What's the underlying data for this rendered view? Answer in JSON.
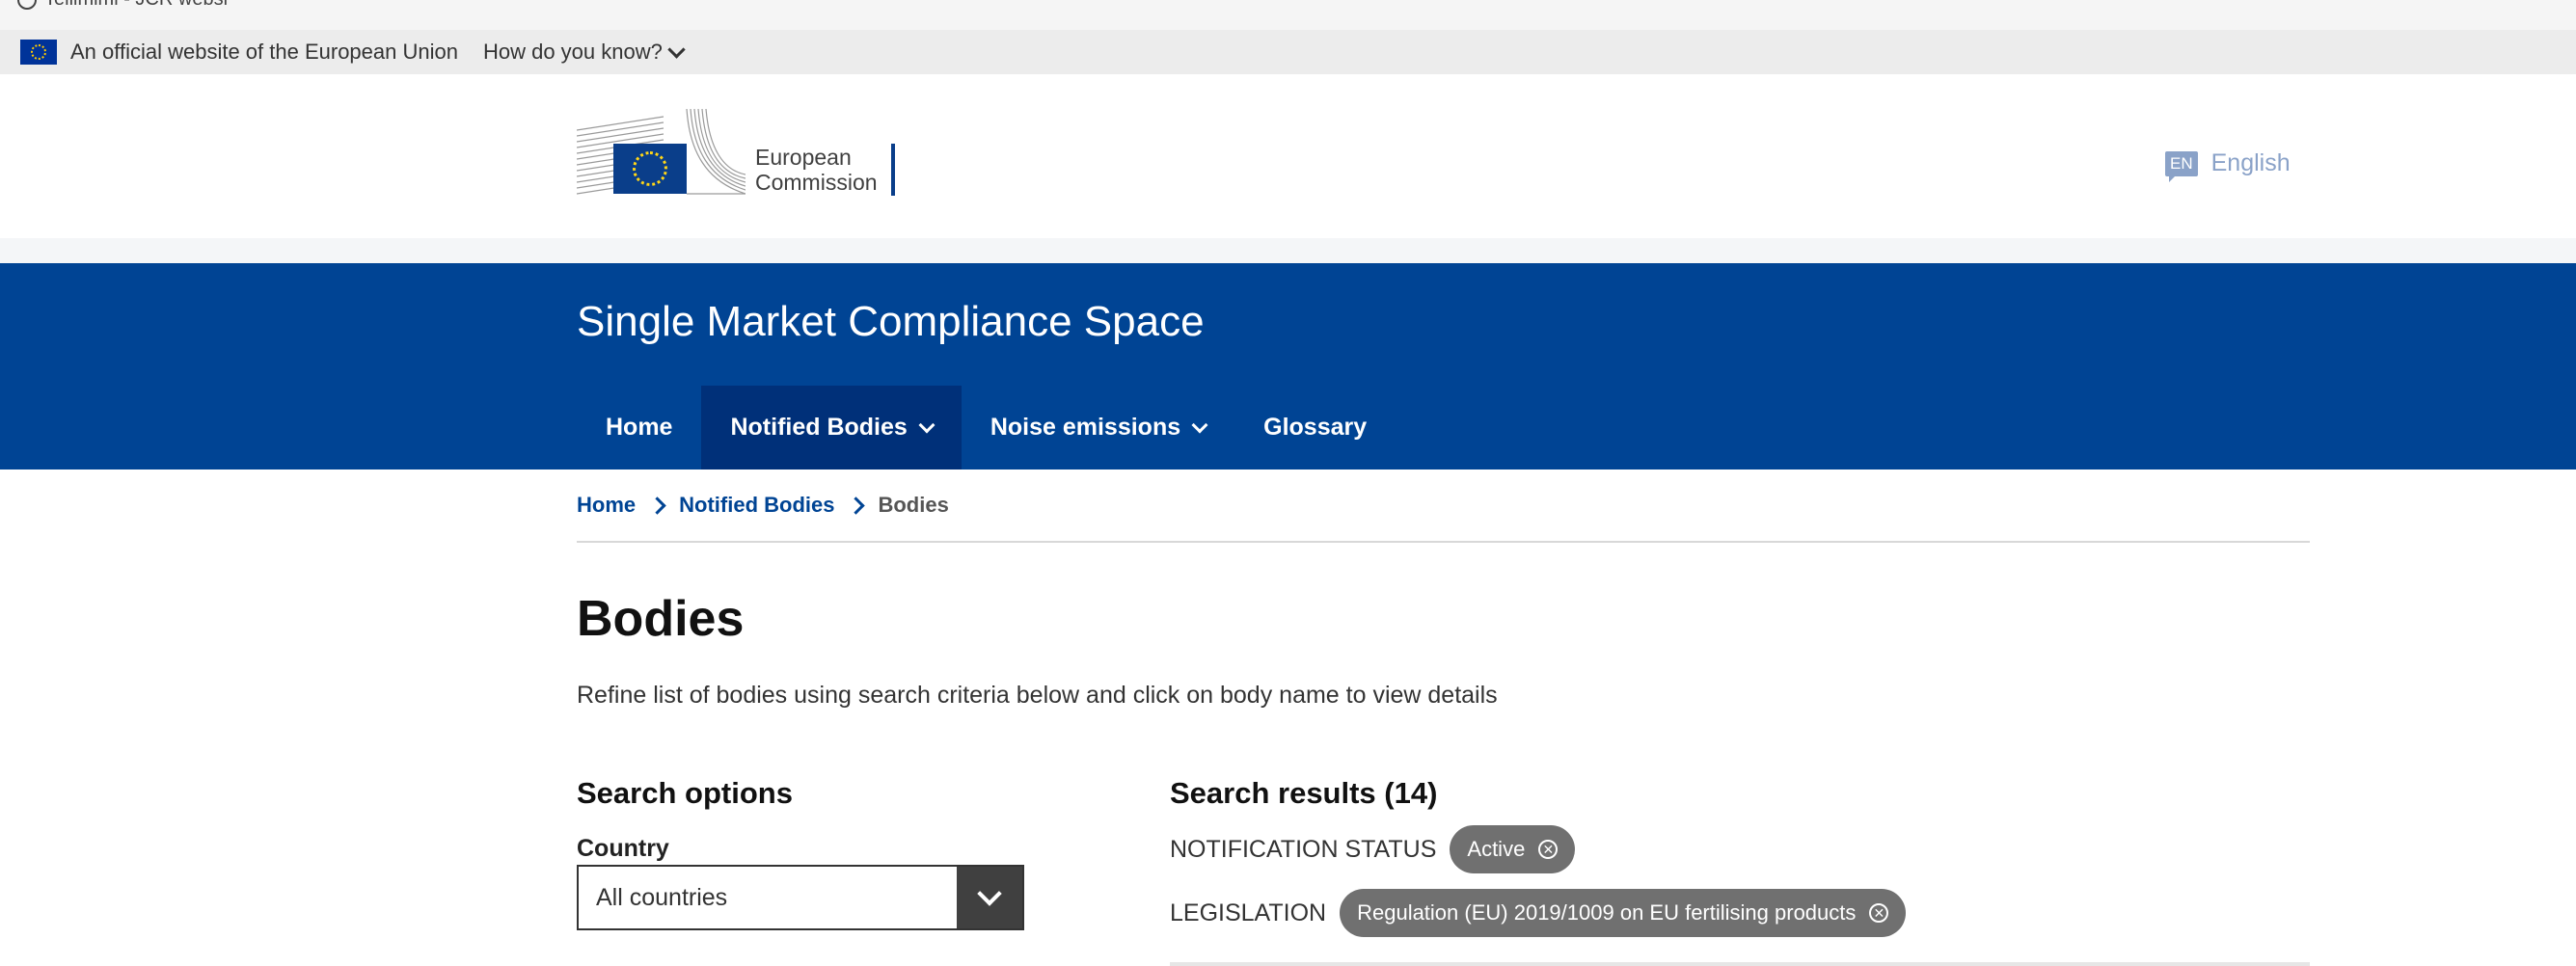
{
  "top_strip": {
    "text": "Tellimimi - JCR websi"
  },
  "eu_banner": {
    "official_text": "An official website of the European Union",
    "how_know": "How do you know?"
  },
  "header": {
    "logo_line1": "European",
    "logo_line2": "Commission",
    "language_code": "EN",
    "language_label": "English"
  },
  "site": {
    "title": "Single Market Compliance Space",
    "nav": [
      {
        "label": "Home"
      },
      {
        "label": "Notified Bodies"
      },
      {
        "label": "Noise emissions"
      },
      {
        "label": "Glossary"
      }
    ]
  },
  "breadcrumb": {
    "items": [
      "Home",
      "Notified Bodies",
      "Bodies"
    ]
  },
  "page": {
    "title": "Bodies",
    "intro": "Refine list of bodies using search criteria below and click on body name to view details"
  },
  "search_options": {
    "title": "Search options",
    "country_label": "Country",
    "country_value": "All countries"
  },
  "search_results": {
    "title": "Search results (14)",
    "filters": [
      {
        "label": "NOTIFICATION STATUS",
        "value": "Active"
      },
      {
        "label": "LEGISLATION",
        "value": "Regulation (EU) 2019/1009 on EU fertilising products"
      }
    ]
  },
  "colors": {
    "brand_blue": "#004494",
    "nav_active": "#003079",
    "chip_grey": "#707070",
    "select_button": "#404040"
  }
}
